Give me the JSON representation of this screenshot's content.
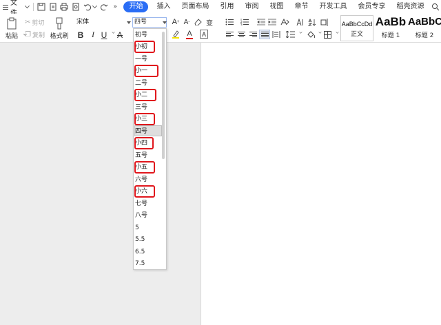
{
  "menubar": {
    "file_label": "文件",
    "tabs": [
      "开始",
      "插入",
      "页面布局",
      "引用",
      "审阅",
      "视图",
      "章节",
      "开发工具",
      "会员专享",
      "稻壳资源"
    ]
  },
  "ribbon": {
    "paste_label": "粘贴",
    "cut_label": "剪切",
    "copy_label": "复制",
    "format_painter_label": "格式刷",
    "font_name": "宋体",
    "font_size": "四号",
    "styles": [
      {
        "sample": "AaBbCcDd",
        "name": "正文"
      },
      {
        "sample": "AaBb",
        "name": "标题 1"
      },
      {
        "sample": "AaBbC",
        "name": "标题 2"
      }
    ]
  },
  "font_size_dropdown": {
    "items": [
      "初号",
      "小初",
      "一号",
      "小一",
      "二号",
      "小二",
      "三号",
      "小三",
      "四号",
      "小四",
      "五号",
      "小五",
      "六号",
      "小六",
      "七号",
      "八号",
      "5",
      "5.5",
      "6.5",
      "7.5"
    ],
    "highlighted": [
      "小初",
      "小一",
      "小二",
      "小三",
      "小四",
      "小五",
      "小六"
    ],
    "current": "四号"
  },
  "colors": {
    "accent": "#2a6df5",
    "highlight_outline": "#e0161c"
  }
}
